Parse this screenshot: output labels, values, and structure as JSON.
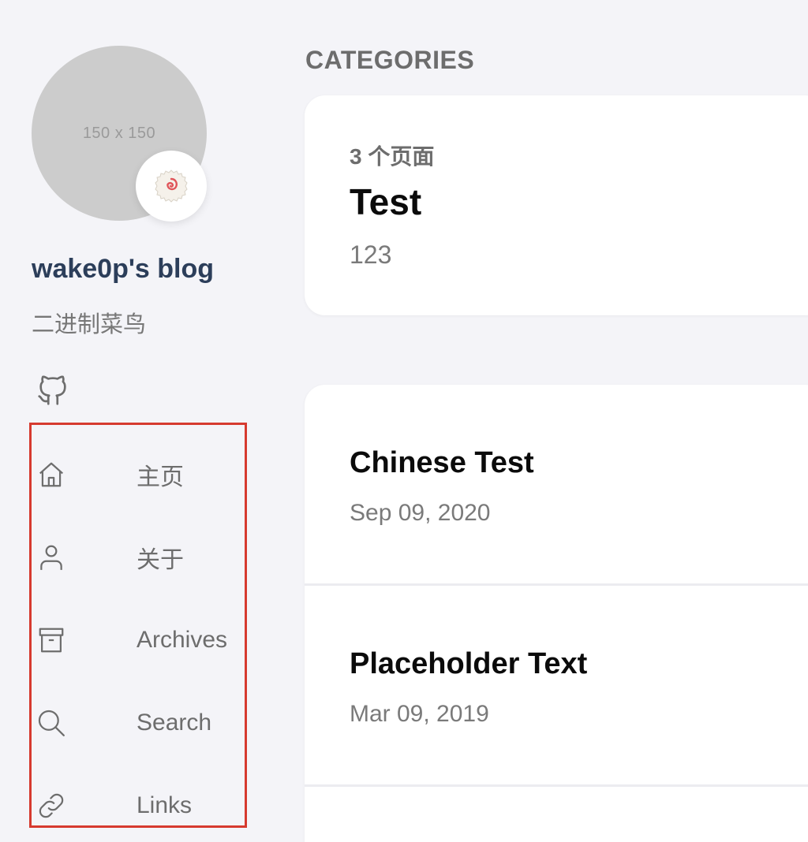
{
  "sidebar": {
    "avatar_text": "150 x 150",
    "title": "wake0p's blog",
    "subtitle": "二进制菜鸟",
    "social_icon": "github-icon",
    "nav": [
      {
        "label": "主页",
        "icon": "home-icon"
      },
      {
        "label": "关于",
        "icon": "user-icon"
      },
      {
        "label": "Archives",
        "icon": "archive-icon"
      },
      {
        "label": "Search",
        "icon": "search-icon"
      },
      {
        "label": "Links",
        "icon": "link-icon"
      }
    ],
    "highlight_color": "#d63a2f"
  },
  "main": {
    "heading": "CATEGORIES",
    "category": {
      "count": "3 个页面",
      "name": "Test",
      "description": "123"
    },
    "posts": [
      {
        "title": "Chinese Test",
        "date": "Sep 09, 2020"
      },
      {
        "title": "Placeholder Text",
        "date": "Mar 09, 2019"
      }
    ]
  },
  "colors": {
    "background": "#f4f4f8",
    "title": "#2c3e5a",
    "card": "#ffffff"
  }
}
